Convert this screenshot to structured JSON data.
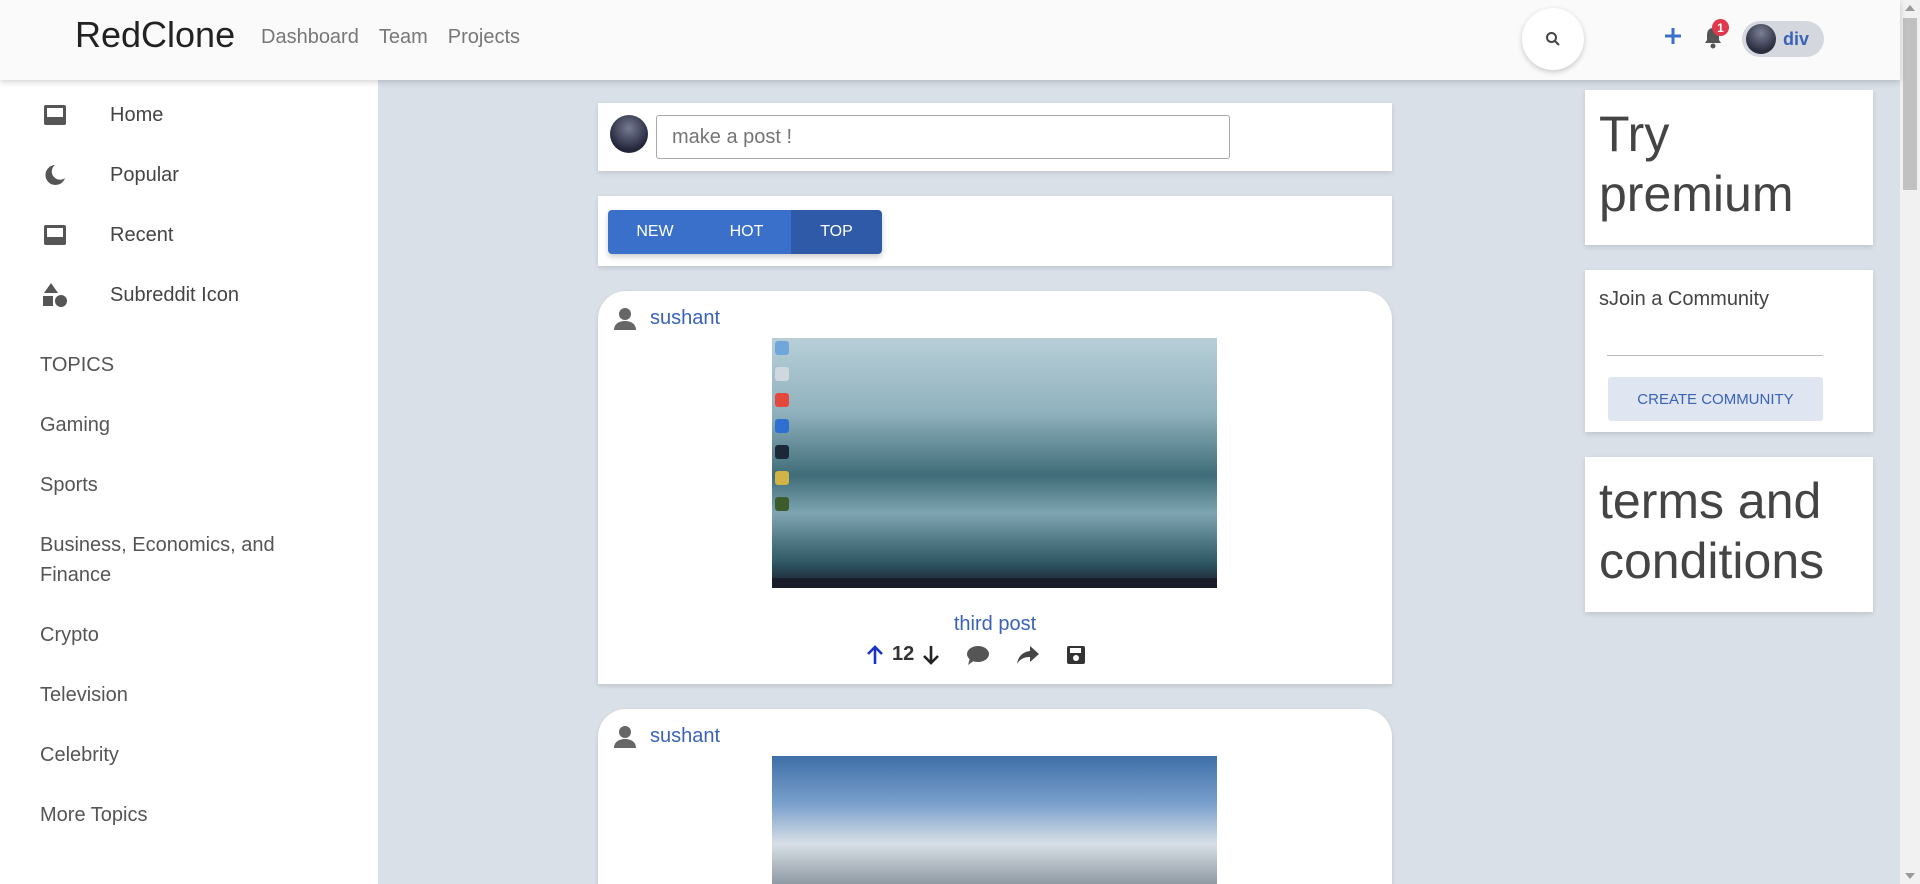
{
  "header": {
    "logo": "RedClone",
    "nav": [
      "Dashboard",
      "Team",
      "Projects"
    ],
    "notification_count": "1",
    "username": "div"
  },
  "sidebar": {
    "items": [
      {
        "label": "Home",
        "icon": "inbox-icon"
      },
      {
        "label": "Popular",
        "icon": "moon-icon"
      },
      {
        "label": "Recent",
        "icon": "inbox-icon"
      },
      {
        "label": "Subreddit Icon",
        "icon": "shapes-icon"
      }
    ],
    "topics_heading": "TOPICS",
    "topics": [
      "Gaming",
      "Sports",
      "Business, Economics, and Finance",
      "Crypto",
      "Television",
      "Celebrity",
      "More Topics"
    ]
  },
  "composer": {
    "placeholder": "make a post !"
  },
  "sort": {
    "options": [
      "NEW",
      "HOT",
      "TOP"
    ],
    "active": "TOP"
  },
  "posts": [
    {
      "author": "sushant",
      "title": "third post",
      "votes": "12"
    },
    {
      "author": "sushant",
      "title": "",
      "votes": ""
    }
  ],
  "right": {
    "premium": "Try premium",
    "community_title": "sJoin a Community",
    "create_label": "CREATE COMMUNITY",
    "terms": "terms and conditions"
  },
  "colors": {
    "accent": "#3a70c9",
    "link": "#3a62b8",
    "badge": "#e0384c",
    "background": "#dae0e8"
  }
}
